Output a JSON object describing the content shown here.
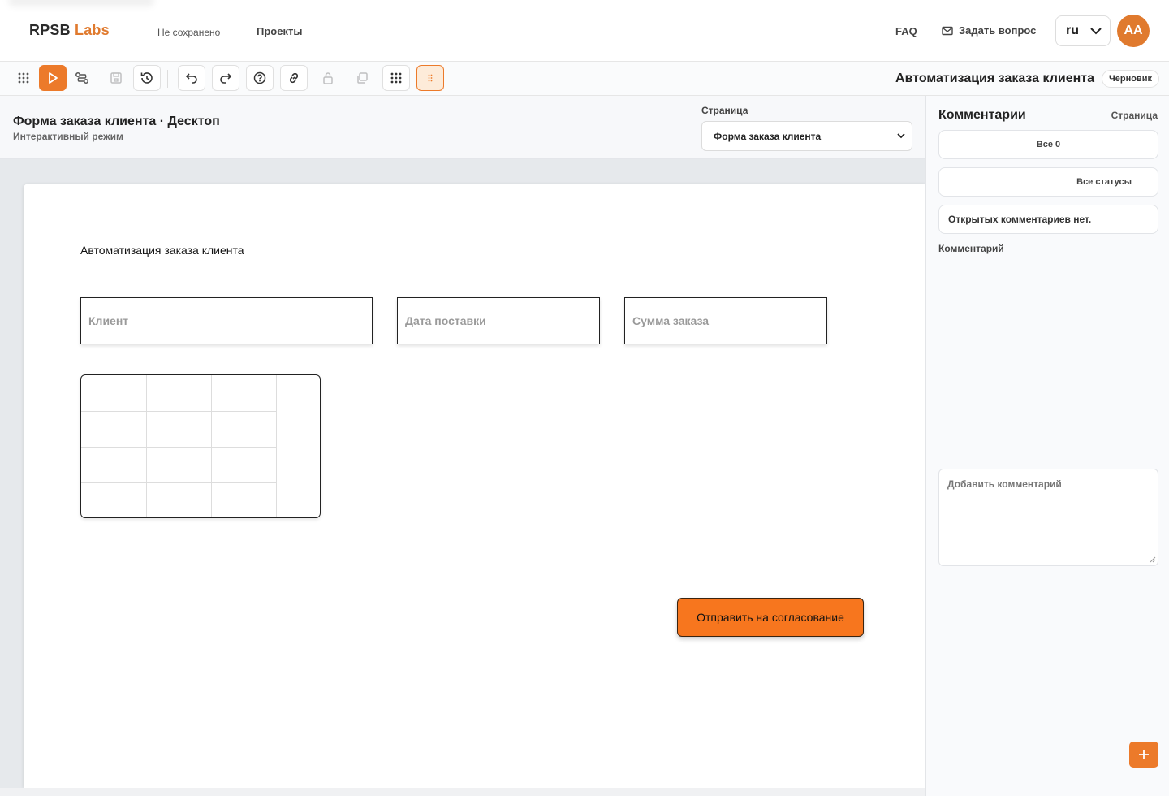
{
  "header": {
    "logo_main": "RPSB",
    "logo_accent": "Labs",
    "save_status": "Не сохранено",
    "nav_projects": "Проекты",
    "faq": "FAQ",
    "ask_question": "Задать вопрос",
    "language": "ru",
    "avatar_initials": "AA"
  },
  "toolbar": {
    "document_title": "Автоматизация заказа клиента",
    "status_badge": "Черновик"
  },
  "subheader": {
    "page_heading": "Форма заказа клиента · Десктоп",
    "mode": "Интерактивный режим",
    "page_label": "Страница",
    "page_selected": "Форма заказа клиента"
  },
  "canvas": {
    "form_title": "Автоматизация заказа клиента",
    "fields": [
      {
        "placeholder": "Клиент"
      },
      {
        "placeholder": "Дата поставки"
      },
      {
        "placeholder": "Сумма заказа"
      }
    ],
    "grid": {
      "rows": 4,
      "cols": 3
    },
    "submit_label": "Отправить на согласование"
  },
  "comments": {
    "title": "Комментарии",
    "scope": "Страница",
    "filter_all": "Все 0",
    "filter_status": "Все статусы",
    "empty_message": "Открытых комментариев нет.",
    "comment_label": "Комментарий",
    "input_placeholder": "Добавить комментарий"
  },
  "colors": {
    "accent": "#ec7a2a",
    "submit": "#f7761e",
    "canvas_bg": "#e6e9ec"
  }
}
